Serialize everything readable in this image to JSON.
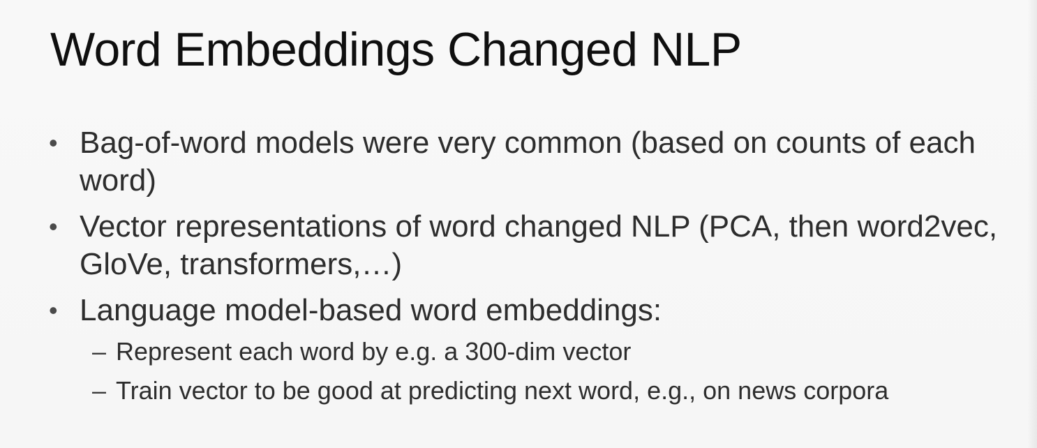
{
  "title": "Word Embeddings Changed NLP",
  "bullets": [
    {
      "text": "Bag-of-word models were very common (based on counts of each word)"
    },
    {
      "text": "Vector representations of word changed NLP (PCA, then word2vec, GloVe, transformers,…)"
    },
    {
      "text": "Language model-based word embeddings:"
    }
  ],
  "sub_bullets": [
    {
      "text": "Represent each word by e.g. a 300-dim vector"
    },
    {
      "text": "Train vector to be good at predicting next word, e.g., on news corpora"
    }
  ],
  "glyphs": {
    "bullet": "•",
    "dash": "–"
  }
}
